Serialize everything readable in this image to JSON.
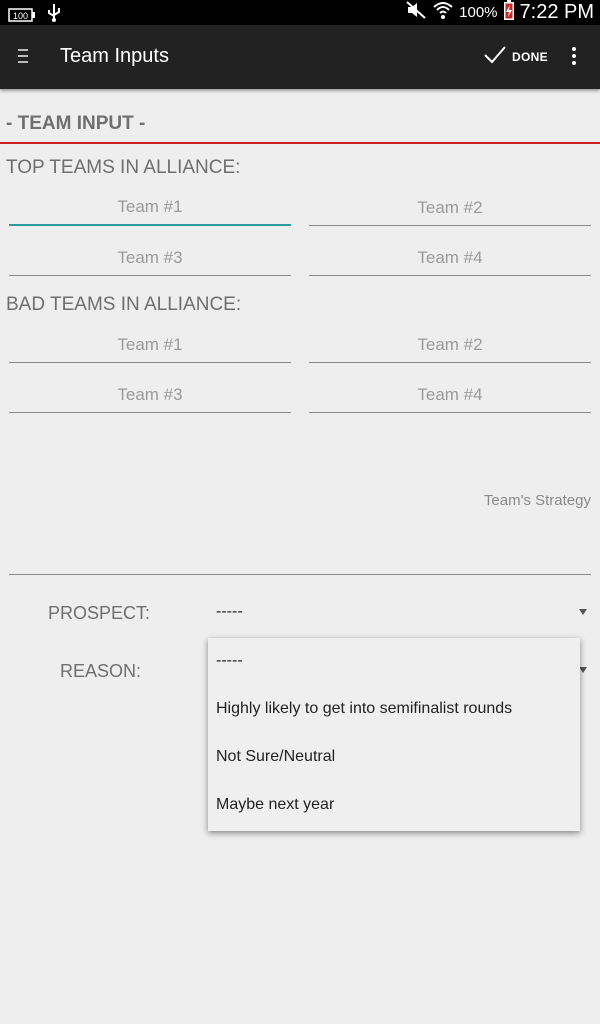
{
  "status_bar": {
    "battery_left_label": "100",
    "battery_percent": "100%",
    "time": "7:22 PM"
  },
  "action_bar": {
    "title": "Team Inputs",
    "done_label": "DONE"
  },
  "section_header": "- TEAM INPUT -",
  "top_teams": {
    "label": "TOP TEAMS IN ALLIANCE:",
    "fields": [
      "Team #1",
      "Team #2",
      "Team #3",
      "Team #4"
    ]
  },
  "bad_teams": {
    "label": "BAD TEAMS IN ALLIANCE:",
    "fields": [
      "Team #1",
      "Team #2",
      "Team #3",
      "Team #4"
    ]
  },
  "strategy": {
    "placeholder": "Team's Strategy"
  },
  "prospect": {
    "label": "PROSPECT:",
    "selected": "-----"
  },
  "reason": {
    "label": "REASON:",
    "options": [
      "-----",
      "Highly likely to get into semifinalist rounds",
      "Not Sure/Neutral",
      "Maybe next year"
    ]
  },
  "colors": {
    "accent_teal": "#2a9d9a",
    "header_rule_red": "#cc1f1f",
    "action_bar": "#222222",
    "background": "#eeeeee"
  },
  "icons": [
    "battery-icon",
    "usb-icon",
    "mute-icon",
    "wifi-icon",
    "battery-charging-icon",
    "menu-icon",
    "check-icon",
    "overflow-menu-icon",
    "dropdown-arrow-icon"
  ]
}
